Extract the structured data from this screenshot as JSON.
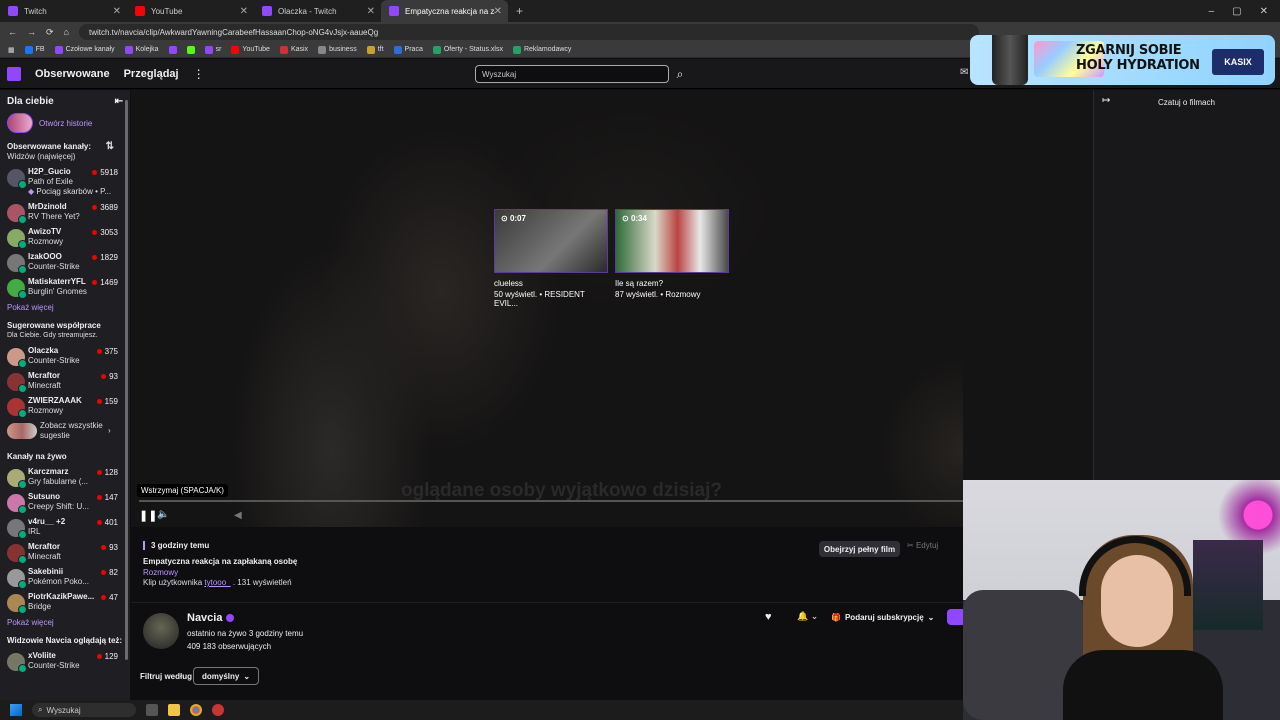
{
  "browser": {
    "tabs": [
      {
        "title": "Twitch",
        "color": "#9147ff"
      },
      {
        "title": "YouTube",
        "color": "#ff0000"
      },
      {
        "title": "Olaczka - Twitch",
        "color": "#9147ff"
      },
      {
        "title": "Empatyczna reakcja na zapłaka",
        "color": "#9147ff"
      }
    ],
    "url": "twitch.tv/navcia/clip/AwkwardYawningCarabeefHassaanChop-oNG4vJsjx-aaueQg",
    "bookmarks": [
      "FB",
      "Czołowe kanały",
      "Kolejka",
      "sr",
      "YouTube",
      "Kasix",
      "business",
      "tft",
      "Praca",
      "Oferty - Status.xlsx",
      "Reklamodawcy"
    ]
  },
  "nav": {
    "following": "Obserwowane",
    "browse": "Przeglądaj",
    "search_placeholder": "Wyszukaj"
  },
  "ad": {
    "headline1": "ZGARNIJ SOBIE",
    "headline2": "HOLY HYDRATION",
    "brand": "KASIX"
  },
  "sidebar": {
    "for_you": "Dla ciebie",
    "open_history": "Otwórz historie",
    "followed_title": "Obserwowane kanały:",
    "followed_sort": "Widzów (najwięcej)",
    "followed": [
      {
        "name": "H2P_Gucio",
        "game": "Path of Exile",
        "viewers": "5918",
        "extra": "Pociąg skarbów • P...",
        "color": "#556"
      },
      {
        "name": "MrDzinold",
        "game": "RV There Yet?",
        "viewers": "3689",
        "color": "#a56"
      },
      {
        "name": "AwizoTV",
        "game": "Rozmowy",
        "viewers": "3053",
        "color": "#8a6"
      },
      {
        "name": "IzakOOO",
        "game": "Counter-Strike",
        "viewers": "1829",
        "color": "#777"
      },
      {
        "name": "MatiskaterrYFL",
        "game": "Burglin' Gnomes",
        "viewers": "1469",
        "color": "#4a4"
      }
    ],
    "show_more": "Pokaż więcej",
    "suggested_title": "Sugerowane współprace",
    "suggested_sub": "Dla Ciebie. Gdy streamujesz.",
    "suggested": [
      {
        "name": "Olaczka",
        "game": "Counter-Strike",
        "viewers": "375",
        "color": "#c98"
      },
      {
        "name": "Mcraftor",
        "game": "Minecraft",
        "viewers": "93",
        "color": "#833"
      },
      {
        "name": "ZWIERZAAAK",
        "game": "Rozmowy",
        "viewers": "159",
        "color": "#a33"
      }
    ],
    "see_all": "Zobacz wszystkie sugestie",
    "live_title": "Kanały na żywo",
    "live": [
      {
        "name": "Karczmarz",
        "game": "Gry fabularne (...",
        "viewers": "128",
        "color": "#aa7"
      },
      {
        "name": "Sutsuno",
        "game": "Creepy Shift: U...",
        "viewers": "147",
        "color": "#c7a"
      },
      {
        "name": "v4ru__ +2",
        "game": "IRL",
        "viewers": "401",
        "color": "#777"
      },
      {
        "name": "Mcraftor",
        "game": "Minecraft",
        "viewers": "93",
        "color": "#833"
      },
      {
        "name": "Sakebinii",
        "game": "Pokémon Poko...",
        "viewers": "82",
        "color": "#999"
      },
      {
        "name": "PiotrKazikPawe...",
        "game": "Bridge",
        "viewers": "47",
        "color": "#a85"
      }
    ],
    "show_more2": "Pokaż więcej",
    "viewers_also_title": "Widzowie Navcia oglądają też:",
    "viewers_also": [
      {
        "name": "xVoliite",
        "game": "Counter-Strike",
        "viewers": "129",
        "color": "#776"
      }
    ]
  },
  "player": {
    "subtitle": "oglądane osoby wyjątkowo dzisiaj?",
    "tooltip": "Wstrzymaj (SPACJA/K)",
    "clips": [
      {
        "duration": "0:07",
        "title": "clueless",
        "meta": "50 wyświetl. • RESIDENT EVIL..."
      },
      {
        "duration": "0:34",
        "title": "Ile są razem?",
        "meta": "87 wyświetl. • Rozmowy"
      }
    ]
  },
  "clip": {
    "time_ago": "3 godziny temu",
    "title": "Empatyczna reakcja na zapłakaną osobę",
    "category": "Rozmowy",
    "by_prefix": "Klip użytkownika",
    "by_user": "tytooo_",
    "views": ". 131 wyświetleń",
    "full_video": "Obejrzyj pełny film",
    "edit": "Edytuj"
  },
  "channel": {
    "name": "Navcia",
    "last_live": "ostatnio na żywo 3 godziny temu",
    "followers": "409 183 obserwujących",
    "subscribe": "Podaruj subskrypcję",
    "filter_label": "Filtruj według",
    "filter_value": "domyślny"
  },
  "right_panel": {
    "title": "Czatuj o filmach"
  },
  "taskbar": {
    "search": "Wyszukaj"
  }
}
